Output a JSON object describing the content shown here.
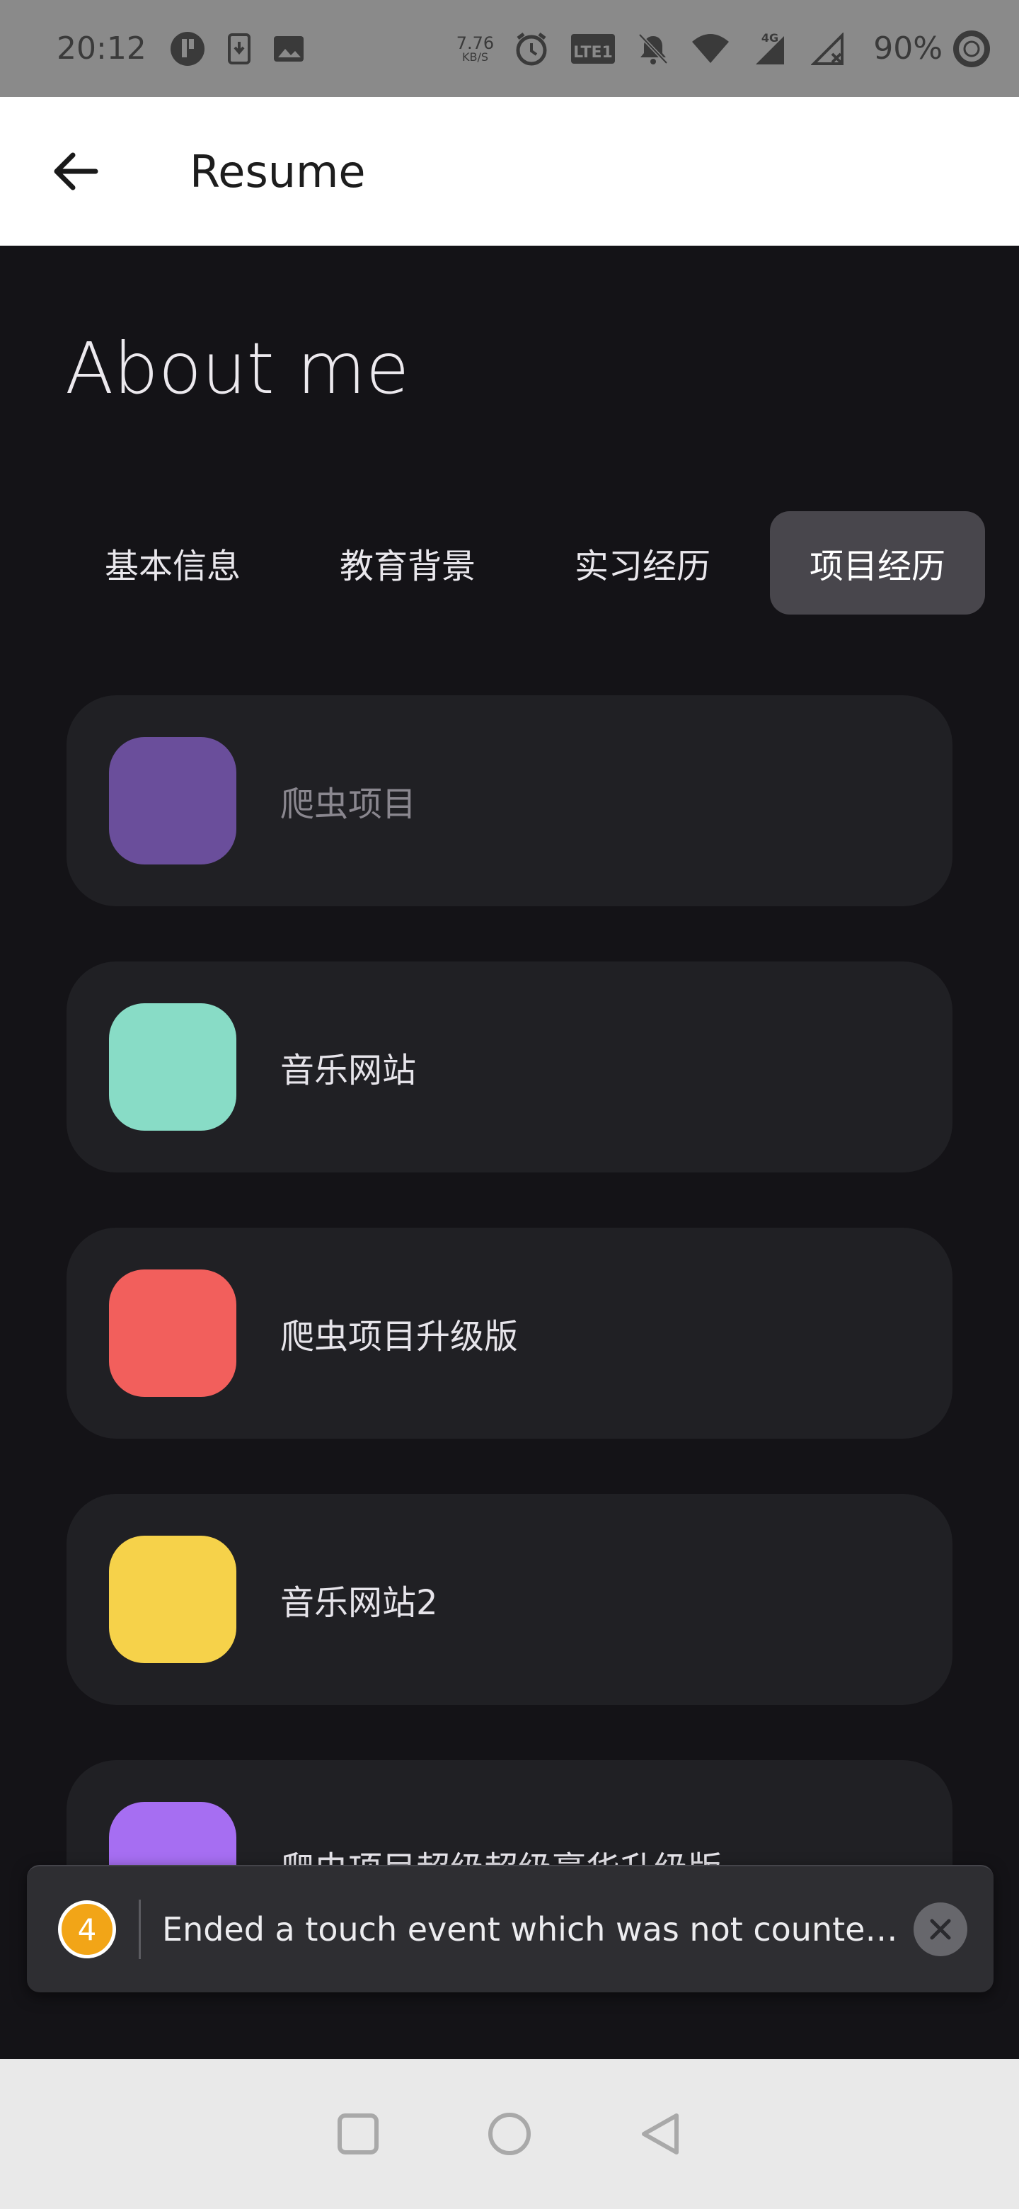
{
  "status_bar": {
    "time": "20:12",
    "net_speed_value": "7.76",
    "net_speed_unit": "KB/S",
    "network_type": "4G",
    "volte_label": "LTE1",
    "battery": "90%"
  },
  "app_bar": {
    "title": "Resume"
  },
  "heading": "About me",
  "tabs": [
    {
      "label": "基本信息",
      "active": false
    },
    {
      "label": "教育背景",
      "active": false
    },
    {
      "label": "实习经历",
      "active": false
    },
    {
      "label": "项目经历",
      "active": true
    }
  ],
  "projects": [
    {
      "label": "爬虫项目",
      "color": "#6a4e9b"
    },
    {
      "label": "音乐网站",
      "color": "#88dcc6"
    },
    {
      "label": "爬虫项目升级版",
      "color": "#f25f5c"
    },
    {
      "label": "音乐网站2",
      "color": "#f6d24a"
    },
    {
      "label": "爬虫项目超级超级豪华升级版",
      "color": "#a66ef2"
    }
  ],
  "toast": {
    "count": "4",
    "message": "Ended a touch event which was not counted in `trackedTouchCount`."
  },
  "colors": {
    "background": "#141317",
    "card": "#202024",
    "active_tab": "#48464c",
    "toast_badge": "#f2a517"
  },
  "icons": {
    "back": "arrow-left-icon",
    "close": "close-icon",
    "nav_recents": "square-icon",
    "nav_home": "circle-icon",
    "nav_back": "triangle-left-icon"
  }
}
